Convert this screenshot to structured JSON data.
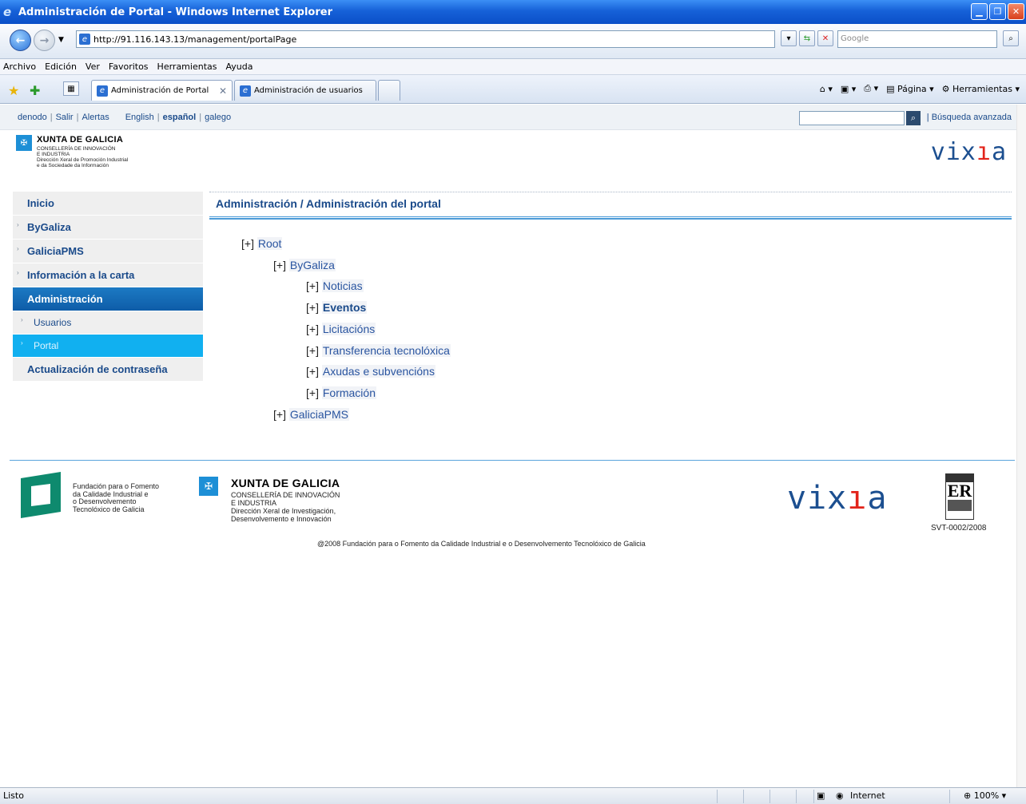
{
  "window": {
    "title": "Administración de Portal - Windows Internet Explorer"
  },
  "browser": {
    "url": "http://91.116.143.13/management/portalPage",
    "search_placeholder": "Google",
    "menu": [
      "Archivo",
      "Edición",
      "Ver",
      "Favoritos",
      "Herramientas",
      "Ayuda"
    ],
    "tabs": [
      {
        "label": "Administración de Portal",
        "active": true
      },
      {
        "label": "Administración de usuarios",
        "active": false
      }
    ],
    "toolbar": {
      "page_label": "Página",
      "tools_label": "Herramientas"
    }
  },
  "topbar": {
    "links": [
      "denodo",
      "Salir",
      "Alertas"
    ],
    "languages": [
      {
        "label": "English",
        "active": false
      },
      {
        "label": "español",
        "active": true
      },
      {
        "label": "galego",
        "active": false
      }
    ],
    "advanced_search": "Búsqueda avanzada"
  },
  "header": {
    "xunta_name": "XUNTA DE GALICIA",
    "xunta_lines": [
      "CONSELLERÍA DE INNOVACIÓN",
      "E INDUSTRIA",
      "Dirección Xeral de Promoción Industrial",
      "e da Sociedade da Información"
    ],
    "logo_text_a": "vix",
    "logo_text_b": "a",
    "logo_accent": "#e2231a",
    "brand_color": "#1c4f90"
  },
  "sidebar": {
    "items": [
      {
        "label": "Inicio"
      },
      {
        "label": "ByGaliza"
      },
      {
        "label": "GaliciaPMS"
      },
      {
        "label": "Información a la carta"
      },
      {
        "label": "Administración"
      },
      {
        "label": "Usuarios"
      },
      {
        "label": "Portal"
      },
      {
        "label": "Actualización de contraseña"
      }
    ]
  },
  "main": {
    "title": "Administración / Administración del portal",
    "toggle": "[+]",
    "tree": [
      {
        "label": "Root"
      },
      {
        "label": "ByGaliza"
      },
      {
        "label": "Noticias"
      },
      {
        "label": "Eventos"
      },
      {
        "label": "Licitacións"
      },
      {
        "label": "Transferencia tecnolóxica"
      },
      {
        "label": "Axudas e subvencións"
      },
      {
        "label": "Formación"
      },
      {
        "label": "GaliciaPMS"
      }
    ]
  },
  "footer": {
    "fundacion_lines": [
      "Fundación para o Fomento",
      "da Calidade Industrial e",
      "o Desenvolvemento",
      "Tecnolóxico de Galicia"
    ],
    "xunta_name": "XUNTA DE GALICIA",
    "xunta_lines": [
      "CONSELLERÍA DE INNOVACIÓN",
      "E INDUSTRIA",
      "Dirección Xeral de Investigación,",
      "Desenvolvemento e Innovación"
    ],
    "aenor_code": "SVT-0002/2008",
    "copyright": "@2008 Fundación para o Fomento da Calidade Industrial e o Desenvolvemento Tecnolóxico de Galicia"
  },
  "status": {
    "left": "Listo",
    "zone": "Internet",
    "zoom": "100%"
  }
}
